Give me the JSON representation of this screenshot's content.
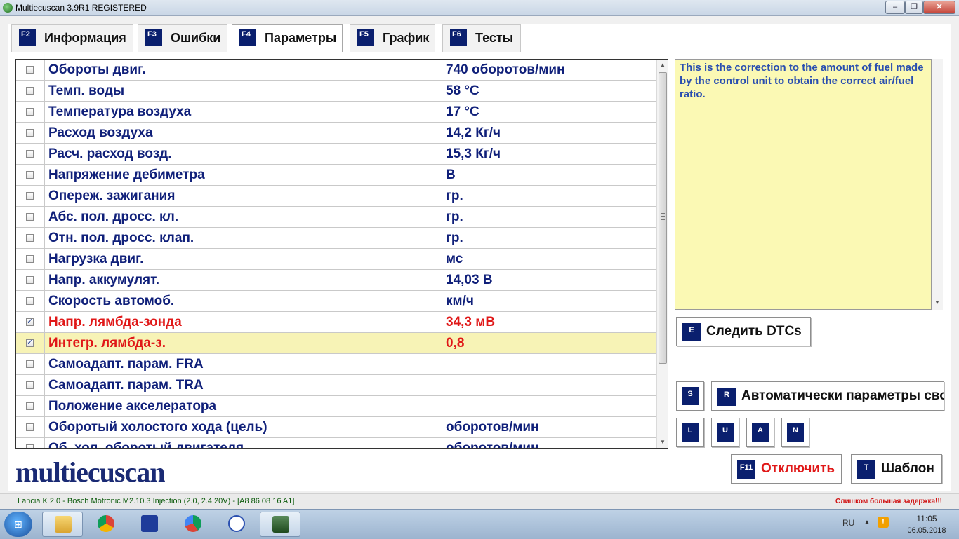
{
  "window": {
    "title": "Multiecuscan 3.9R1 REGISTERED"
  },
  "window_controls": {
    "minimize": "‒",
    "maximize": "❐",
    "close": "✕"
  },
  "tabs": [
    {
      "key": "F2",
      "label": "Информация"
    },
    {
      "key": "F3",
      "label": "Ошибки"
    },
    {
      "key": "F4",
      "label": "Параметры",
      "active": true
    },
    {
      "key": "F5",
      "label": "График"
    },
    {
      "key": "F6",
      "label": "Тесты"
    }
  ],
  "parameters": [
    {
      "name": "Обороты двиг.",
      "value": "740 оборотов/мин",
      "checked": false
    },
    {
      "name": "Темп. воды",
      "value": "58 °C",
      "checked": false
    },
    {
      "name": "Температура воздуха",
      "value": "17 °C",
      "checked": false
    },
    {
      "name": "Расход воздуха",
      "value": "14,2 Кг/ч",
      "checked": false
    },
    {
      "name": "Расч. расход возд.",
      "value": "15,3 Кг/ч",
      "checked": false
    },
    {
      "name": "Напряжение дебиметра",
      "value": " В",
      "checked": false
    },
    {
      "name": "Опереж. зажигания",
      "value": " гр.",
      "checked": false
    },
    {
      "name": "Абс. пол. дросс. кл.",
      "value": " гр.",
      "checked": false
    },
    {
      "name": "Отн. пол. дросс. клап.",
      "value": " гр.",
      "checked": false
    },
    {
      "name": "Нагрузка двиг.",
      "value": " мс",
      "checked": false
    },
    {
      "name": "Напр. аккумулят.",
      "value": "14,03 В",
      "checked": false
    },
    {
      "name": "Скорость автомоб.",
      "value": " км/ч",
      "checked": false
    },
    {
      "name": "Напр. лямбда-зонда",
      "value": "34,3 мВ",
      "checked": true,
      "highlight": "red"
    },
    {
      "name": "Интегр. лямбда-з.",
      "value": "0,8",
      "checked": true,
      "highlight": "red",
      "selected": true
    },
    {
      "name": "Самоадапт. парам. FRA",
      "value": "",
      "checked": false
    },
    {
      "name": "Самоадапт. парам. TRA",
      "value": "",
      "checked": false
    },
    {
      "name": "Положение акселератора",
      "value": "",
      "checked": false
    },
    {
      "name": "Оборотый холостого хода (цель)",
      "value": " оборотов/мин",
      "checked": false
    },
    {
      "name": "Об. хол. оборотый двигателя",
      "value": " оборотов/мин",
      "checked": false
    }
  ],
  "description": "This is the correction to the amount of fuel made by the control unit to obtain the correct air/fuel ratio.",
  "buttons": {
    "monitor": {
      "key": "E",
      "label": "Следить DTCs"
    },
    "s": {
      "key": "S"
    },
    "auto": {
      "key": "R",
      "label": "Автоматически параметры своб"
    },
    "l": {
      "key": "L"
    },
    "u": {
      "key": "U"
    },
    "a": {
      "key": "A"
    },
    "n": {
      "key": "N"
    },
    "disconnect": {
      "key": "F11",
      "label": "Отключить"
    },
    "template": {
      "key": "T",
      "label": "Шаблон"
    }
  },
  "logo": "multiecuscan",
  "status": {
    "vehicle": "Lancia K 2.0 - Bosch Motronic M2.10.3 Injection (2.0, 2.4 20V) - [A8 86 08 16 A1]",
    "warning": "Слишком большая задержка!!!"
  },
  "taskbar": {
    "lang": "RU",
    "time": "11:05",
    "date": "06.05.2018"
  },
  "colors": {
    "key_badge": "#0a1f6e",
    "param_text": "#10207a",
    "alert": "#e01818",
    "desc_bg": "#fbf9b4"
  }
}
